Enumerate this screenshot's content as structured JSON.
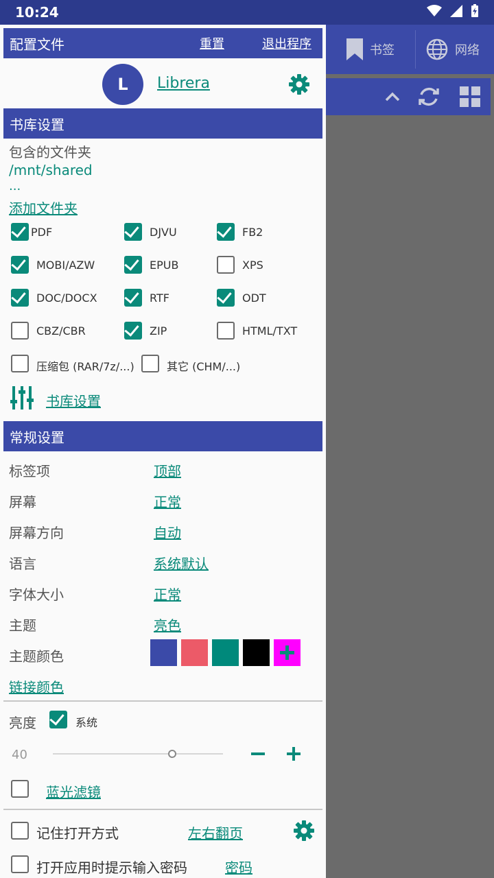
{
  "status_bar": {
    "time": "10:24"
  },
  "background": {
    "tabs": [
      {
        "label": "书签"
      },
      {
        "label": "网络"
      }
    ]
  },
  "drawer": {
    "header": {
      "title": "配置文件",
      "reset": "重置",
      "exit": "退出程序"
    },
    "profile": {
      "initial": "L",
      "name": "Librera"
    },
    "library": {
      "title": "书库设置",
      "folders_label": "包含的文件夹",
      "folder_path": "/mnt/shared",
      "folder_more": "...",
      "add_folder": "添加文件夹",
      "formats": [
        {
          "label": "PDF",
          "checked": true
        },
        {
          "label": "DJVU",
          "checked": true
        },
        {
          "label": "FB2",
          "checked": true
        },
        {
          "label": "MOBI/AZW",
          "checked": true
        },
        {
          "label": "EPUB",
          "checked": true
        },
        {
          "label": "XPS",
          "checked": false
        },
        {
          "label": "DOC/DOCX",
          "checked": true
        },
        {
          "label": "RTF",
          "checked": true
        },
        {
          "label": "ODT",
          "checked": true
        },
        {
          "label": "CBZ/CBR",
          "checked": false
        },
        {
          "label": "ZIP",
          "checked": true
        },
        {
          "label": "HTML/TXT",
          "checked": false
        },
        {
          "label": "压缩包 (RAR/7z/...)",
          "checked": false
        },
        {
          "label": "其它 (CHM/...)",
          "checked": false
        }
      ],
      "settings_link": "书库设置"
    },
    "general": {
      "title": "常规设置",
      "rows": [
        {
          "label": "标签项",
          "value": "顶部"
        },
        {
          "label": "屏幕",
          "value": "正常"
        },
        {
          "label": "屏幕方向",
          "value": "自动"
        },
        {
          "label": "语言",
          "value": "系统默认"
        },
        {
          "label": "字体大小",
          "value": "正常"
        },
        {
          "label": "主题",
          "value": "亮色"
        }
      ],
      "theme_color_label": "主题颜色",
      "theme_colors": [
        "#3b4aa8",
        "#ec5a68",
        "#00897b",
        "#000000",
        "#ff00ff"
      ],
      "link_color": "链接颜色",
      "brightness_label": "亮度",
      "brightness_system": "系统",
      "brightness_value": "40",
      "brightness_level": 0.7,
      "blue_filter": "蓝光滤镜",
      "remember_open": "记住打开方式",
      "page_mode": "左右翻页",
      "password_prompt": "打开应用时提示输入密码",
      "password_link": "密码"
    }
  },
  "colors": {
    "primary": "#3b4aa8",
    "accent": "#0a8a7a"
  }
}
